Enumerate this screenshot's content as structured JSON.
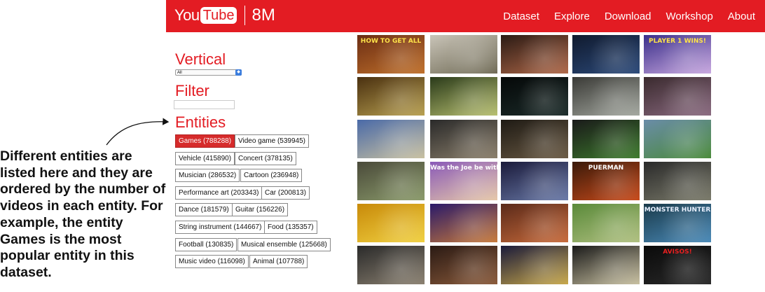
{
  "header": {
    "logo_you": "You",
    "logo_tube": "Tube",
    "logo_suffix": "8M",
    "nav": [
      "Dataset",
      "Explore",
      "Download",
      "Workshop",
      "About"
    ],
    "bg_color": "#e31c23"
  },
  "left_panel": {
    "vertical_title": "Vertical",
    "vertical_selected": "All",
    "filter_title": "Filter",
    "filter_value": "",
    "entities_title": "Entities",
    "entities": [
      {
        "label": "Games (788288)",
        "selected": true
      },
      {
        "label": "Video game (539945)",
        "selected": false
      },
      {
        "label": "Vehicle (415890)",
        "selected": false
      },
      {
        "label": "Concert (378135)",
        "selected": false
      },
      {
        "label": "Musician (286532)",
        "selected": false
      },
      {
        "label": "Cartoon (236948)",
        "selected": false
      },
      {
        "label": "Performance art (203343)",
        "selected": false
      },
      {
        "label": "Car (200813)",
        "selected": false
      },
      {
        "label": "Dance (181579)",
        "selected": false
      },
      {
        "label": "Guitar (156226)",
        "selected": false
      },
      {
        "label": "String instrument (144667)",
        "selected": false
      },
      {
        "label": "Food (135357)",
        "selected": false
      },
      {
        "label": "Football (130835)",
        "selected": false
      },
      {
        "label": "Musical ensemble (125668)",
        "selected": false
      },
      {
        "label": "Music video (116098)",
        "selected": false
      },
      {
        "label": "Animal (107788)",
        "selected": false
      }
    ]
  },
  "annotation": {
    "text": "Different entities are listed here and they are ordered by the number of videos in each entity. For example, the entity Games is the most popular entity in this dataset."
  },
  "thumbnails": [
    {
      "icon": "game-thumbnail",
      "colors": [
        "#6b2d14",
        "#c0702a"
      ],
      "text": "HOW TO GET ALL",
      "text_color": "#ffe34a"
    },
    {
      "icon": "flight-sim-thumbnail",
      "colors": [
        "#c9c4b8",
        "#6f6a55"
      ]
    },
    {
      "icon": "movie-thumbnail",
      "colors": [
        "#2a1a14",
        "#b06848"
      ]
    },
    {
      "icon": "game-thumbnail",
      "colors": [
        "#101a2e",
        "#2c4a7a"
      ]
    },
    {
      "icon": "fighting-game-thumbnail",
      "colors": [
        "#3a2f8a",
        "#c9a8e0"
      ],
      "text": "PLAYER 1 WINS!",
      "text_color": "#ffe34a"
    },
    {
      "icon": "slot-machine-thumbnail",
      "colors": [
        "#4a3010",
        "#b8a050"
      ]
    },
    {
      "icon": "game-thumbnail",
      "colors": [
        "#2a3a1a",
        "#b8c070"
      ]
    },
    {
      "icon": "game-thumbnail",
      "colors": [
        "#050808",
        "#1c2c2a"
      ]
    },
    {
      "icon": "game-thumbnail",
      "colors": [
        "#3a3a36",
        "#a4a8a0"
      ]
    },
    {
      "icon": "game-thumbnail",
      "colors": [
        "#3a2a2e",
        "#8a6a80"
      ]
    },
    {
      "icon": "map-game-thumbnail",
      "colors": [
        "#4a6aa8",
        "#c8c0a0"
      ]
    },
    {
      "icon": "vlog-thumbnail",
      "colors": [
        "#2a2a2a",
        "#8a7e6a"
      ]
    },
    {
      "icon": "gym-thumbnail",
      "colors": [
        "#1e1a14",
        "#6a5a44"
      ]
    },
    {
      "icon": "baseball-thumbnail",
      "colors": [
        "#1a1a1a",
        "#3c7a2c"
      ]
    },
    {
      "icon": "soccer-thumbnail",
      "colors": [
        "#6a8ca8",
        "#4a8a3a"
      ]
    },
    {
      "icon": "game-thumbnail",
      "colors": [
        "#4a4a3a",
        "#8a9a6a"
      ]
    },
    {
      "icon": "anime-thumbnail",
      "colors": [
        "#8a5ab8",
        "#e6c8a8"
      ],
      "text": "Was the Joe be with the?",
      "text_color": "#ffffff"
    },
    {
      "icon": "robot-thumbnail",
      "colors": [
        "#1a1a3a",
        "#6a7aa8"
      ]
    },
    {
      "icon": "game-thumbnail",
      "colors": [
        "#3a1a0a",
        "#c84a1a"
      ],
      "text": "PUERMAN",
      "text_color": "#ffffff"
    },
    {
      "icon": "game-thumbnail",
      "colors": [
        "#2a2a2a",
        "#7a7a6a"
      ]
    },
    {
      "icon": "game-thumbnail",
      "colors": [
        "#c88a0a",
        "#f0d040"
      ]
    },
    {
      "icon": "retro-game-thumbnail",
      "colors": [
        "#2a1a6a",
        "#c87a3a"
      ]
    },
    {
      "icon": "basketball-thumbnail",
      "colors": [
        "#5a2a1a",
        "#c86a3a"
      ]
    },
    {
      "icon": "football-thumbnail",
      "colors": [
        "#5a8a3a",
        "#b0c080"
      ]
    },
    {
      "icon": "monster-hunter-thumbnail",
      "colors": [
        "#1a3a4a",
        "#4a8ab8"
      ],
      "text": "MONSTER HUNTER",
      "text_color": "#e8f0ff"
    },
    {
      "icon": "phone-thumbnail",
      "colors": [
        "#2a2a2a",
        "#8a8070"
      ]
    },
    {
      "icon": "game-thumbnail",
      "colors": [
        "#2a1a14",
        "#8a5a3a"
      ]
    },
    {
      "icon": "anime-fight-thumbnail",
      "colors": [
        "#1a1a3a",
        "#c8a84a"
      ]
    },
    {
      "icon": "tv-thumbnail",
      "colors": [
        "#1a1a1a",
        "#c8c0a0"
      ]
    },
    {
      "icon": "title-card-thumbnail",
      "colors": [
        "#0a0a0a",
        "#2a2a2a"
      ],
      "text": "AVISOS!",
      "text_color": "#e82020"
    }
  ]
}
